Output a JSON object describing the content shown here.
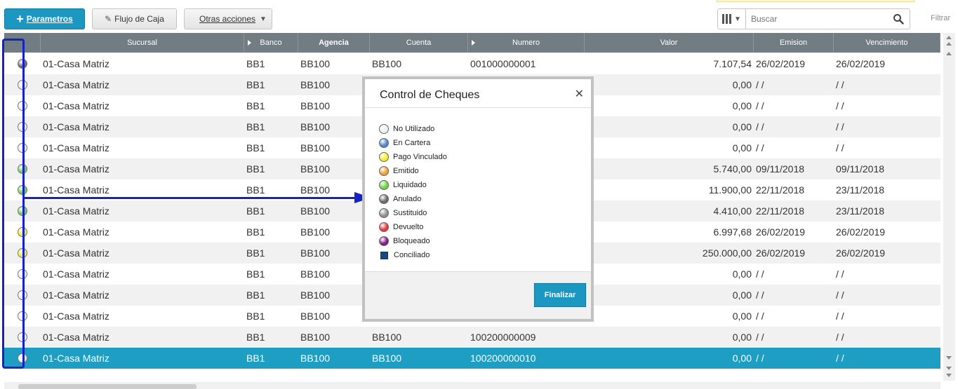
{
  "toolbar": {
    "parametros_label": "Parametros",
    "flujo_label": "Flujo de Caja",
    "otras_label": "Otras acciones",
    "search_placeholder": "Buscar",
    "filtrar_label": "Filtrar"
  },
  "grid": {
    "columns": [
      "Sucursal",
      "Banco",
      "Agencia",
      "Cuenta",
      "Numero",
      "Valor",
      "Emision",
      "Vencimiento"
    ],
    "rows": [
      {
        "status": "anulado",
        "sucursal": "01-Casa Matriz",
        "banco": "BB1",
        "agencia": "BB100",
        "cuenta": "BB100",
        "numero": "001000000001",
        "valor": "7.107,54",
        "emision": "26/02/2019",
        "vencimiento": "26/02/2019"
      },
      {
        "status": "no-utilizado",
        "sucursal": "01-Casa Matriz",
        "banco": "BB1",
        "agencia": "BB100",
        "cuenta": "",
        "numero": "",
        "valor": "0,00",
        "emision": " / /",
        "vencimiento": " / /"
      },
      {
        "status": "no-utilizado",
        "sucursal": "01-Casa Matriz",
        "banco": "BB1",
        "agencia": "BB100",
        "cuenta": "",
        "numero": "",
        "valor": "0,00",
        "emision": " / /",
        "vencimiento": " / /"
      },
      {
        "status": "no-utilizado",
        "sucursal": "01-Casa Matriz",
        "banco": "BB1",
        "agencia": "BB100",
        "cuenta": "",
        "numero": "",
        "valor": "0,00",
        "emision": " / /",
        "vencimiento": " / /"
      },
      {
        "status": "no-utilizado",
        "sucursal": "01-Casa Matriz",
        "banco": "BB1",
        "agencia": "BB100",
        "cuenta": "",
        "numero": "",
        "valor": "0,00",
        "emision": " / /",
        "vencimiento": " / /"
      },
      {
        "status": "liquidado",
        "sucursal": "01-Casa Matriz",
        "banco": "BB1",
        "agencia": "BB100",
        "cuenta": "",
        "numero": "",
        "valor": "5.740,00",
        "emision": "09/11/2018",
        "vencimiento": "09/11/2018"
      },
      {
        "status": "liquidado",
        "sucursal": "01-Casa Matriz",
        "banco": "BB1",
        "agencia": "BB100",
        "cuenta": "",
        "numero": "",
        "valor": "11.900,00",
        "emision": "22/11/2018",
        "vencimiento": "23/11/2018"
      },
      {
        "status": "liquidado",
        "sucursal": "01-Casa Matriz",
        "banco": "BB1",
        "agencia": "BB100",
        "cuenta": "",
        "numero": "",
        "valor": "4.410,00",
        "emision": "22/11/2018",
        "vencimiento": "23/11/2018"
      },
      {
        "status": "pago-vinculado",
        "sucursal": "01-Casa Matriz",
        "banco": "BB1",
        "agencia": "BB100",
        "cuenta": "",
        "numero": "",
        "valor": "6.997,68",
        "emision": "26/02/2019",
        "vencimiento": "26/02/2019"
      },
      {
        "status": "pago-vinculado",
        "sucursal": "01-Casa Matriz",
        "banco": "BB1",
        "agencia": "BB100",
        "cuenta": "",
        "numero": "",
        "valor": "250.000,00",
        "emision": "26/02/2019",
        "vencimiento": "26/02/2019"
      },
      {
        "status": "no-utilizado",
        "sucursal": "01-Casa Matriz",
        "banco": "BB1",
        "agencia": "BB100",
        "cuenta": "",
        "numero": "",
        "valor": "0,00",
        "emision": " / /",
        "vencimiento": " / /"
      },
      {
        "status": "no-utilizado",
        "sucursal": "01-Casa Matriz",
        "banco": "BB1",
        "agencia": "BB100",
        "cuenta": "",
        "numero": "",
        "valor": "0,00",
        "emision": " / /",
        "vencimiento": " / /"
      },
      {
        "status": "no-utilizado",
        "sucursal": "01-Casa Matriz",
        "banco": "BB1",
        "agencia": "BB100",
        "cuenta": "",
        "numero": "",
        "valor": "0,00",
        "emision": " / /",
        "vencimiento": " / /"
      },
      {
        "status": "no-utilizado",
        "sucursal": "01-Casa Matriz",
        "banco": "BB1",
        "agencia": "BB100",
        "cuenta": "BB100",
        "numero": "100200000009",
        "valor": "0,00",
        "emision": " / /",
        "vencimiento": " / /"
      },
      {
        "status": "no-utilizado",
        "sucursal": "01-Casa Matriz",
        "banco": "BB1",
        "agencia": "BB100",
        "cuenta": "BB100",
        "numero": "100200000010",
        "valor": "0,00",
        "emision": " / /",
        "vencimiento": " / /",
        "selected": true
      }
    ]
  },
  "status_colors": {
    "no-utilizado": "#eeeeee",
    "en-cartera": "#4f86c6",
    "pago-vinculado": "#f2ee2c",
    "emitido": "#f0a03a",
    "liquidado": "#6fd33d",
    "anulado": "#6b6b6b",
    "sustituido": "#8f8f8f",
    "devuelto": "#e23b3b",
    "bloqueado": "#7d1a86",
    "conciliado": "#0d4c8a"
  },
  "dialog": {
    "title": "Control de Cheques",
    "close_icon": "close-icon",
    "legend": [
      {
        "key": "no-utilizado",
        "label": "No Utilizado"
      },
      {
        "key": "en-cartera",
        "label": "En Cartera"
      },
      {
        "key": "pago-vinculado",
        "label": "Pago Vinculado"
      },
      {
        "key": "emitido",
        "label": "Emitido"
      },
      {
        "key": "liquidado",
        "label": "Liquidado"
      },
      {
        "key": "anulado",
        "label": "Anulado"
      },
      {
        "key": "sustituido",
        "label": "Sustituido"
      },
      {
        "key": "devuelto",
        "label": "Devuelto"
      },
      {
        "key": "bloqueado",
        "label": "Bloqueado"
      },
      {
        "key": "conciliado",
        "label": "Conciliado"
      }
    ],
    "finalizar_label": "Finalizar"
  }
}
